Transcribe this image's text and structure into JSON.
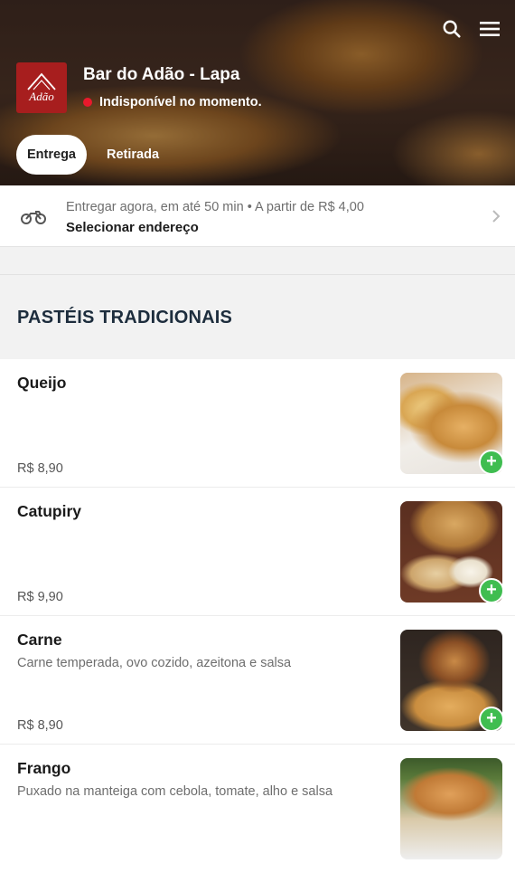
{
  "header": {
    "store_name": "Bar do Adão - Lapa",
    "status_text": "Indisponível no momento.",
    "status_color": "#e8192c",
    "logo_text": "Adão",
    "brand_color": "#a71e1e",
    "icons": [
      "search-icon",
      "menu-icon"
    ]
  },
  "mode_tabs": [
    {
      "label": "Entrega",
      "active": true
    },
    {
      "label": "Retirada",
      "active": false
    }
  ],
  "delivery": {
    "line1": "Entregar agora, em até 50 min • A partir de R$ 4,00",
    "line2": "Selecionar endereço",
    "icon": "motorcycle-icon"
  },
  "section": {
    "title": "PASTÉIS TRADICIONAIS"
  },
  "items": [
    {
      "name": "Queijo",
      "description": "",
      "price": "R$ 8,90",
      "add_label": "+"
    },
    {
      "name": "Catupiry",
      "description": "",
      "price": "R$ 9,90",
      "add_label": "+"
    },
    {
      "name": "Carne",
      "description": "Carne temperada, ovo cozido, azeitona e salsa",
      "price": "R$ 8,90",
      "add_label": "+"
    },
    {
      "name": "Frango",
      "description": "Puxado na manteiga com cebola, tomate, alho e salsa",
      "price": "",
      "add_label": "+"
    }
  ],
  "accent_color": "#3fbd50"
}
